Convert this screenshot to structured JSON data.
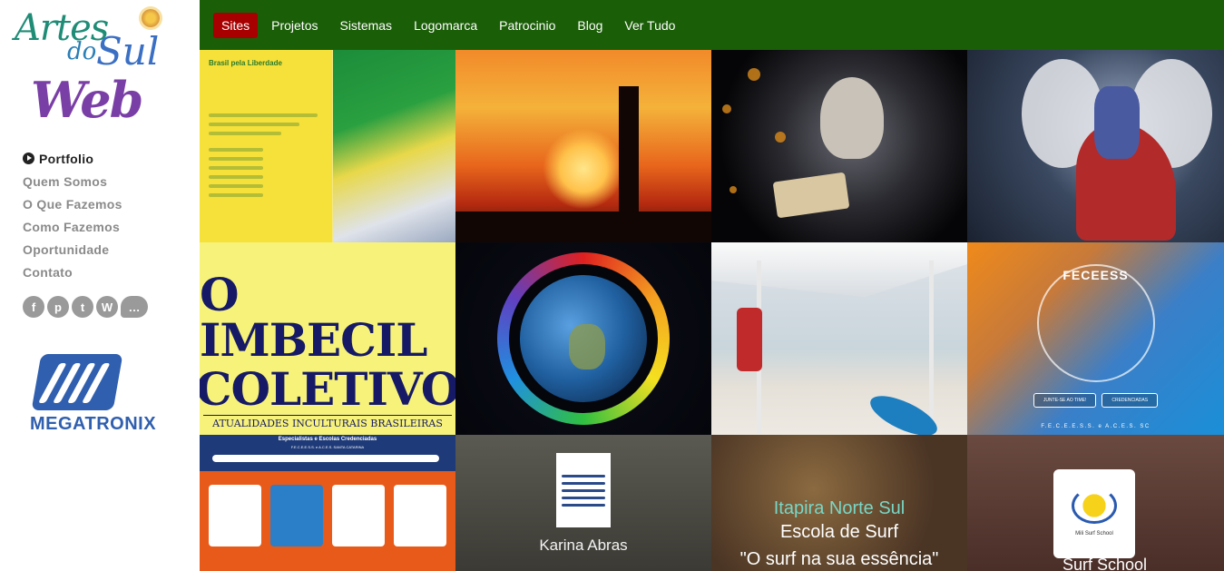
{
  "logo": {
    "word1": "Artes",
    "word2": "do",
    "word3": "Sul",
    "word4": "Web"
  },
  "sidebar": {
    "menu": [
      {
        "label": "Portfolio",
        "active": true
      },
      {
        "label": "Quem Somos"
      },
      {
        "label": "O Que Fazemos"
      },
      {
        "label": "Como Fazemos"
      },
      {
        "label": "Oportunidade"
      },
      {
        "label": "Contato"
      }
    ],
    "social": [
      "f",
      "p",
      "t",
      "W",
      "…"
    ],
    "sponsor": "MEGATRONIX"
  },
  "topnav": {
    "items": [
      "Sites",
      "Projetos",
      "Sistemas",
      "Logomarca",
      "Patrocinio",
      "Blog",
      "Ver Tudo"
    ],
    "active": "Sites"
  },
  "tiles": {
    "brasil": {
      "title": "Brasil pela Liberdade"
    },
    "imbecil": {
      "line1": "O IMBECIL",
      "line2": "COLETIVO",
      "line3": "ATUALIDADES INCULTURAIS BRASILEIRAS"
    },
    "fecess": {
      "title": "FECEESS",
      "btn1": "JUNTE-SE AO TIME!",
      "btn2": "CREDENCIADAS",
      "footer": "F.E.C.E.E.S.S. e A.C.E.S. SC"
    },
    "escolas": {
      "title": "Especialistas e Escolas Credenciadas",
      "subtitle": "F.E.C.E.E.S.S. e A.C.E.S. SANTA CATARINA"
    },
    "karina": {
      "name": "Karina Abras"
    },
    "itapira": {
      "line1": "Itapira Norte Sul",
      "line2": "Escola de Surf",
      "line3": "\"O surf na sua essência\""
    },
    "mili": {
      "caption": "Mili Surf School",
      "bottom": "Surf School"
    }
  },
  "colors": {
    "nav_bg": "#1b5e08",
    "nav_active": "#a80000",
    "sidebar_text": "#8a8a8a"
  }
}
